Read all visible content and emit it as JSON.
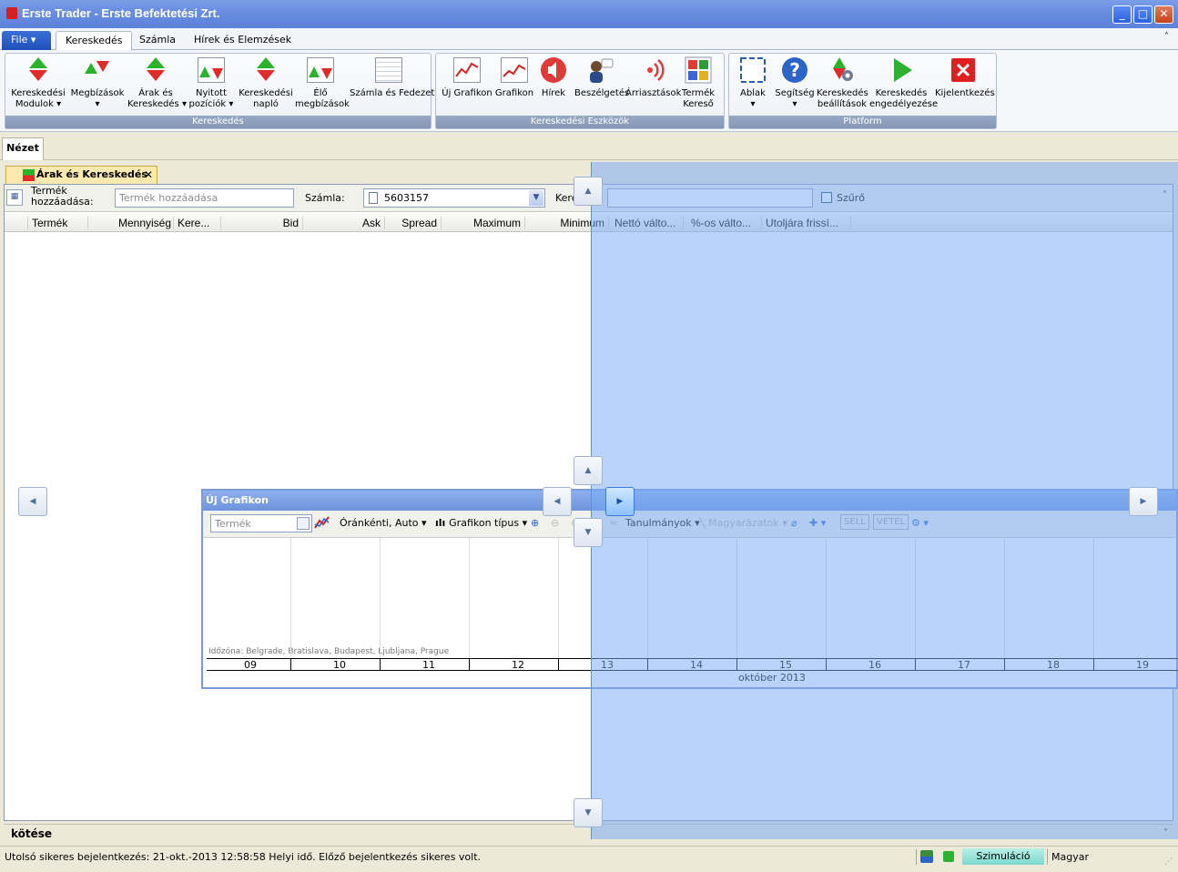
{
  "window": {
    "title": "Erste Trader - Erste Befektetési Zrt."
  },
  "ribbon_tabs": {
    "file": "File",
    "tabs": [
      "Kereskedés",
      "Számla",
      "Hírek és Elemzések"
    ]
  },
  "ribbon": {
    "groups": [
      {
        "label": "Kereskedés",
        "buttons": [
          {
            "l1": "Kereskedési",
            "l2": "Modulok"
          },
          {
            "l1": "Megbízások",
            "l2": ""
          },
          {
            "l1": "Árak és",
            "l2": "Kereskedés"
          },
          {
            "l1": "Nyitott",
            "l2": "pozíciók"
          },
          {
            "l1": "Kereskedési",
            "l2": "napló"
          },
          {
            "l1": "Élő",
            "l2": "megbízások"
          },
          {
            "l1": "Számla és Fedezet",
            "l2": ""
          }
        ]
      },
      {
        "label": "Kereskedési Eszközök",
        "buttons": [
          {
            "l1": "Új Grafikon",
            "l2": ""
          },
          {
            "l1": "Grafikon",
            "l2": ""
          },
          {
            "l1": "Hírek",
            "l2": ""
          },
          {
            "l1": "Beszélgetés",
            "l2": ""
          },
          {
            "l1": "Árriasztások",
            "l2": ""
          },
          {
            "l1": "Termék",
            "l2": "Kereső"
          }
        ]
      },
      {
        "label": "Platform",
        "buttons": [
          {
            "l1": "Ablak",
            "l2": ""
          },
          {
            "l1": "Segítség",
            "l2": ""
          },
          {
            "l1": "Kereskedés",
            "l2": "beállítások"
          },
          {
            "l1": "Kereskedés",
            "l2": "engedélyezése"
          },
          {
            "l1": "Kijelentkezés",
            "l2": ""
          }
        ]
      }
    ]
  },
  "view_tab": "Nézet",
  "doc_tab": {
    "label": "Árak és Kereskedés",
    "close": "✕"
  },
  "filter": {
    "add_label_1": "Termék",
    "add_label_2": "hozzáadása:",
    "add_placeholder": "Termék hozzáadása",
    "account_label": "Számla:",
    "account_value": "5603157",
    "search_label": "Keresés:",
    "filter_label": "Szűrő"
  },
  "columns": [
    "Termék",
    "Mennyiség",
    "Kere...",
    "Bid",
    "Ask",
    "Spread",
    "Maximum",
    "Minimum",
    "Nettó válto...",
    "%-os válto...",
    "Utoljára frissí..."
  ],
  "chart_window": {
    "title": "Új Grafikon",
    "product_placeholder": "Termék",
    "interval": "Óránkénti,  Auto",
    "chart_type": "Grafikon típus",
    "studies": "Tanulmányok",
    "annotations": "Magyarázatok",
    "sell": "SELL",
    "buy": "VÉTEL",
    "timezone": "Időzóna: Belgrade, Bratislava, Budapest, Ljubljana, Prague",
    "days": [
      "09",
      "10",
      "11",
      "12",
      "13",
      "14",
      "15",
      "16",
      "17",
      "18",
      "19"
    ],
    "month": "október 2013"
  },
  "bottom_panel": "kötése",
  "status": {
    "message": "Utolsó sikeres bejelentkezés: 21-okt.-2013 12:58:58 Helyi idő. Előző bejelentkezés sikeres volt.",
    "mode": "Szimuláció",
    "language": "Magyar"
  },
  "colors": {
    "accent": "#5b83d8",
    "overlay": "#78aaf5",
    "sim_badge": "#8fe0d6"
  }
}
